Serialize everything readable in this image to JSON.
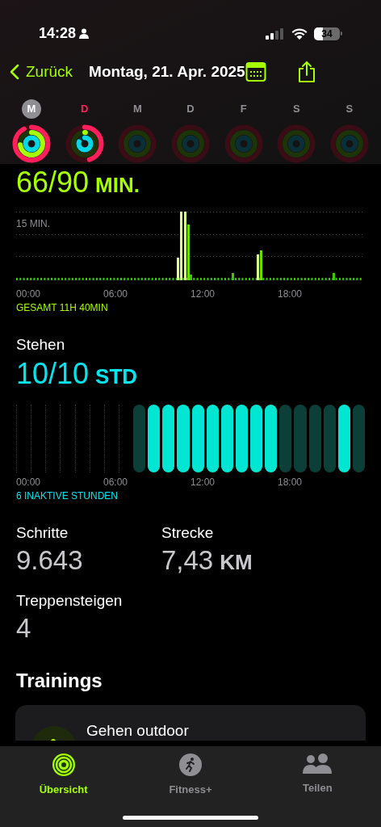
{
  "status_bar": {
    "time": "14:28",
    "battery": "34"
  },
  "nav": {
    "back": "Zurück",
    "title": "Montag, 21. Apr. 2025"
  },
  "days": [
    {
      "label": "M",
      "selected": true,
      "today": false
    },
    {
      "label": "D",
      "selected": false,
      "today": true
    },
    {
      "label": "M",
      "selected": false,
      "today": false
    },
    {
      "label": "D",
      "selected": false,
      "today": false
    },
    {
      "label": "F",
      "selected": false,
      "today": false
    },
    {
      "label": "S",
      "selected": false,
      "today": false
    },
    {
      "label": "S",
      "selected": false,
      "today": false
    }
  ],
  "exercise": {
    "value": "66/90",
    "unit": "MIN.",
    "chart_top_label": "15 MIN.",
    "x_labels": [
      "00:00",
      "06:00",
      "12:00",
      "18:00"
    ],
    "total": "GESAMT 11H 40MIN"
  },
  "stand": {
    "title": "Stehen",
    "value": "10/10",
    "unit": "STD",
    "hours": [
      {
        "stood": false
      },
      {
        "stood": true
      },
      {
        "stood": true
      },
      {
        "stood": true
      },
      {
        "stood": true
      },
      {
        "stood": true
      },
      {
        "stood": true
      },
      {
        "stood": true
      },
      {
        "stood": true
      },
      {
        "stood": true
      },
      {
        "stood": false
      },
      {
        "stood": false
      },
      {
        "stood": false
      },
      {
        "stood": false
      },
      {
        "stood": true
      },
      {
        "stood": false
      }
    ],
    "x_labels": [
      "00:00",
      "06:00",
      "12:00",
      "18:00"
    ],
    "summary": "6 INAKTIVE STUNDEN"
  },
  "stats": [
    {
      "label": "Schritte",
      "value": "9.643"
    },
    {
      "label": "Strecke",
      "value": "7,43",
      "unit": "KM"
    },
    {
      "label": "Treppensteigen",
      "value": "4"
    }
  ],
  "workouts": {
    "title": "Trainings",
    "items": [
      {
        "name": "Gehen outdoor"
      }
    ]
  },
  "tab_bar": [
    {
      "label": "Übersicht",
      "selected": true,
      "kind": "rings"
    },
    {
      "label": "Fitness+",
      "selected": false,
      "kind": "runner"
    },
    {
      "label": "Teilen",
      "selected": false,
      "kind": "people"
    }
  ]
}
